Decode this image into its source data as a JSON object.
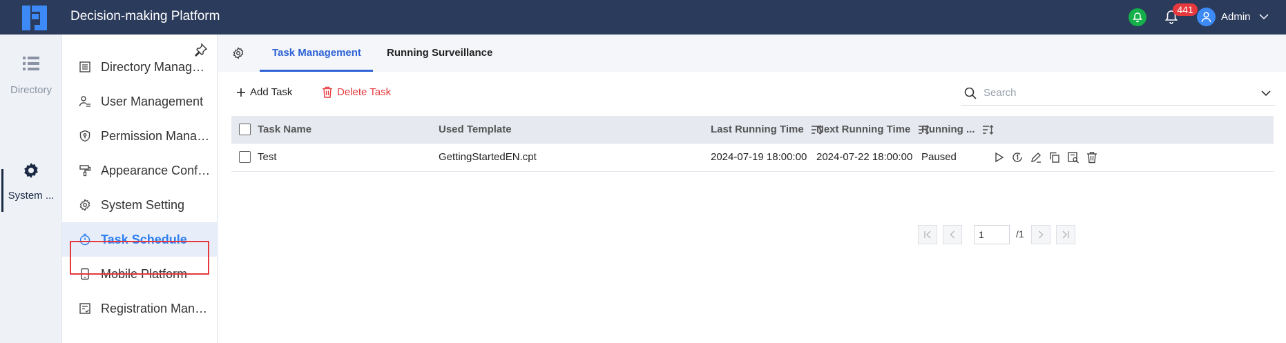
{
  "header": {
    "title": "Decision-making Platform",
    "notification_count": "441",
    "user_name": "Admin"
  },
  "rail": {
    "items": [
      {
        "label": "Directory",
        "icon": "list-icon"
      },
      {
        "label": "System ...",
        "icon": "gear-icon"
      }
    ]
  },
  "menu": {
    "items": [
      {
        "label": "Directory Management",
        "icon": "directory-icon"
      },
      {
        "label": "User Management",
        "icon": "user-icon"
      },
      {
        "label": "Permission Management",
        "icon": "shield-icon"
      },
      {
        "label": "Appearance Configuration",
        "icon": "paint-roller-icon"
      },
      {
        "label": "System Setting",
        "icon": "gear-icon"
      },
      {
        "label": "Task Schedule",
        "icon": "timer-icon"
      },
      {
        "label": "Mobile Platform",
        "icon": "mobile-icon"
      },
      {
        "label": "Registration Management",
        "icon": "registration-icon"
      }
    ],
    "active": "Task Schedule"
  },
  "tabs": [
    {
      "label": "Task Management"
    },
    {
      "label": "Running Surveillance"
    }
  ],
  "toolbar": {
    "add_label": "Add Task",
    "delete_label": "Delete Task",
    "search_placeholder": "Search"
  },
  "table": {
    "columns": [
      "Task Name",
      "Used Template",
      "Last Running Time",
      "Next Running Time",
      "Running ..."
    ],
    "rows": [
      {
        "task_name": "Test",
        "template": "GettingStartedEN.cpt",
        "last_run": "2024-07-19 18:00:00",
        "next_run": "2024-07-22 18:00:00",
        "status": "Paused"
      }
    ]
  },
  "pager": {
    "current": "1",
    "total": "/1"
  },
  "colors": {
    "header_bg": "#2b3b5b",
    "accent": "#2e7ff0",
    "tab_active": "#2e62d6",
    "danger": "#e5393d",
    "notify_green": "#16b04a"
  }
}
